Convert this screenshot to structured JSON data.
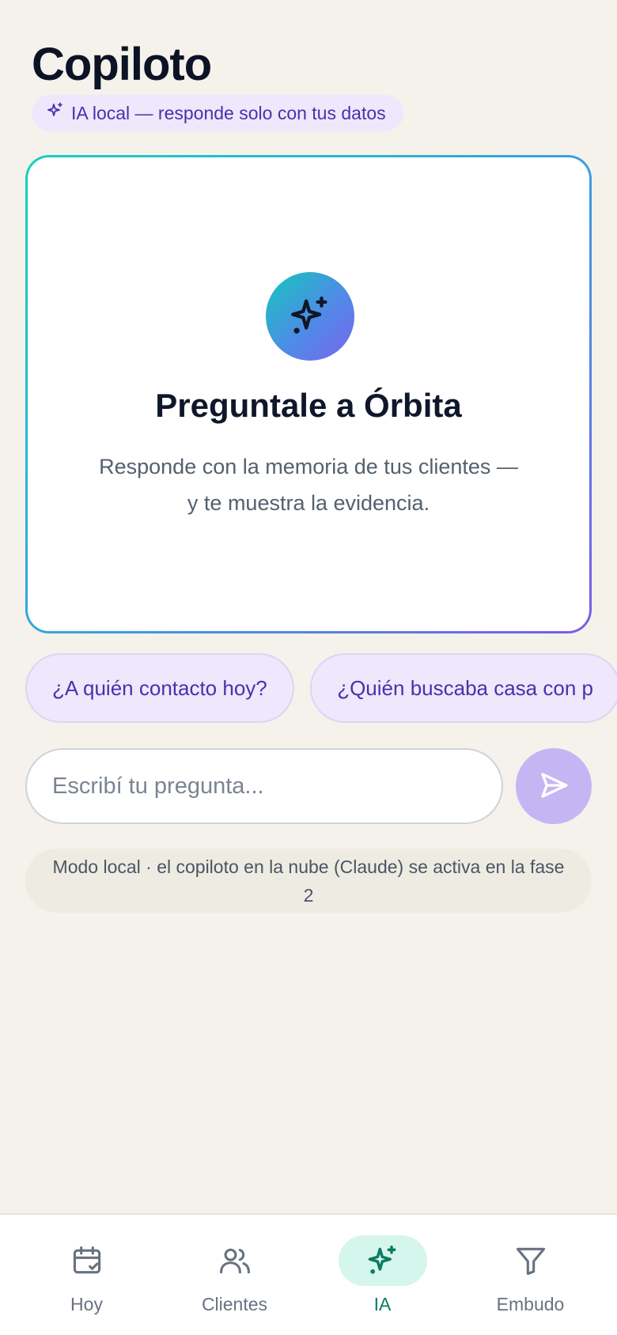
{
  "header": {
    "title": "Copiloto",
    "badge_label": "IA local — responde solo con tus datos"
  },
  "hero": {
    "title": "Preguntale a Órbita",
    "description": "Responde con la memoria de tus clientes — y te muestra la evidencia."
  },
  "suggestions": [
    {
      "label": "¿A quién contacto hoy?"
    },
    {
      "label": "¿Quién buscaba casa con p"
    }
  ],
  "input": {
    "placeholder": "Escribí tu pregunta...",
    "value": ""
  },
  "notice": "Modo local · el copiloto en la nube (Claude) se activa en la fase 2",
  "nav": {
    "items": [
      {
        "label": "Hoy",
        "icon": "calendar-check-icon"
      },
      {
        "label": "Clientes",
        "icon": "users-icon"
      },
      {
        "label": "IA",
        "icon": "sparkles-icon",
        "active": true
      },
      {
        "label": "Embudo",
        "icon": "filter-icon"
      }
    ]
  },
  "colors": {
    "background": "#f5f2ec",
    "accent_purple": "#4c2fae",
    "accent_teal": "#0d7a62",
    "send_button": "#c5b6f3"
  }
}
